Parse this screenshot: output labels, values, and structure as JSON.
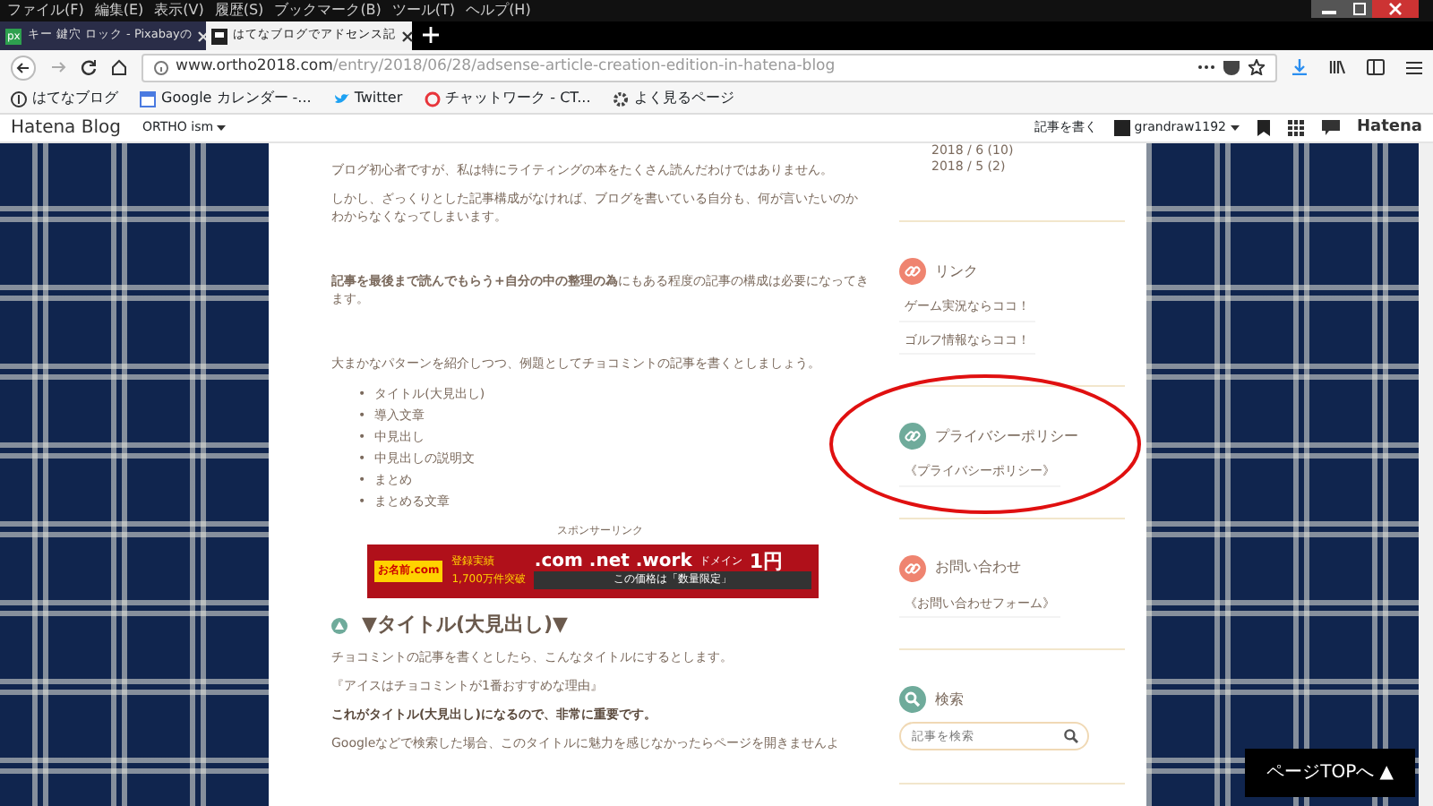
{
  "menu_bar": [
    "ファイル(F)",
    "編集(E)",
    "表示(V)",
    "履歴(S)",
    "ブックマーク(B)",
    "ツール(T)",
    "ヘルプ(H)"
  ],
  "tabs": [
    {
      "label": "キー 鍵穴 ロック - Pixabayの",
      "badge": "px",
      "selected": false
    },
    {
      "label": "はてなブログでアドセンス記",
      "selected": true
    }
  ],
  "url": {
    "domain": "www.ortho2018.com",
    "path": "/entry/2018/06/28/adsense-article-creation-edition-in-hatena-blog"
  },
  "bookmarks": [
    {
      "label": "はてなブログ",
      "kind": "hatena"
    },
    {
      "label": "Google カレンダー -...",
      "kind": "calendar"
    },
    {
      "label": "Twitter",
      "kind": "bird"
    },
    {
      "label": "チャットワーク - CT...",
      "kind": "chat"
    },
    {
      "label": "よく見るページ",
      "kind": "gear"
    }
  ],
  "hatena_bar": {
    "logo": "Hatena Blog",
    "blog": "ORTHO ism",
    "write": "記事を書く",
    "user": "grandraw1192",
    "brand": "Hatena"
  },
  "article": [
    {
      "kind": "p",
      "text": "ブログ初心者ですが、私は特にライティングの本をたくさん読んだわけではありません。"
    },
    {
      "kind": "p",
      "text": "しかし、ざっくりとした記事構成がなければ、ブログを書いている自分も、何が言いたいのかわからなくなってしまいます。"
    },
    {
      "kind": "break"
    },
    {
      "kind": "p",
      "text": "**記事を最後まで読んでもらう+自分の中の整理の為**にもある程度の記事の構成は必要になってきます。"
    },
    {
      "kind": "break"
    },
    {
      "kind": "p",
      "text": "大まかなパターンを紹介しつつ、例題としてチョコミントの記事を書くとしましょう。"
    },
    {
      "kind": "list",
      "marker": "•",
      "items": [
        "タイトル(大見出し)",
        "導入文章",
        "中見出し",
        "中見出しの説明文",
        "まとめ",
        "まとめる文章"
      ]
    },
    {
      "kind": "sponsor",
      "text": "スポンサーリンク"
    },
    {
      "kind": "ad",
      "brand": "お名前.com",
      "record": "登録実績",
      "count": "1,700万件突破",
      "domains": ".com .net .work",
      "label": "ドメイン",
      "price": "1円",
      "note": "この価格は「数量限定」"
    },
    {
      "kind": "heading",
      "text": "▼タイトル(大見出し)▼"
    },
    {
      "kind": "p",
      "text": "チョコミントの記事を書くとしたら、こんなタイトルにするとします。"
    },
    {
      "kind": "p",
      "text": "『アイスはチョコミントが1番おすすめな理由』"
    },
    {
      "kind": "bold",
      "text": "これがタイトル(大見出し)になるので、非常に重要です。"
    },
    {
      "kind": "p",
      "text": "Googleなどで検索した場合、このタイトルに魅力を感じなかったらページを開きませんよ"
    }
  ],
  "sidebar": {
    "archive": [
      "2018 / 6 (10)",
      "2018 / 5 (2)"
    ],
    "modules": [
      {
        "kind": "links",
        "title": "リンク",
        "color": "#ef8470",
        "items": [
          "ゲーム実況ならココ！",
          "ゴルフ情報ならココ！"
        ]
      },
      {
        "kind": "links",
        "title": "プライバシーポリシー",
        "color": "#6fab9b",
        "items": [
          "《プライバシーポリシー》"
        ]
      },
      {
        "kind": "links",
        "title": "お問い合わせ",
        "color": "#ef8470",
        "items": [
          "《お問い合わせフォーム》"
        ]
      },
      {
        "kind": "search",
        "title": "検索",
        "color": "#6fab9b",
        "placeholder": "記事を検索"
      }
    ]
  },
  "page_top": "ページTOPへ ▲"
}
